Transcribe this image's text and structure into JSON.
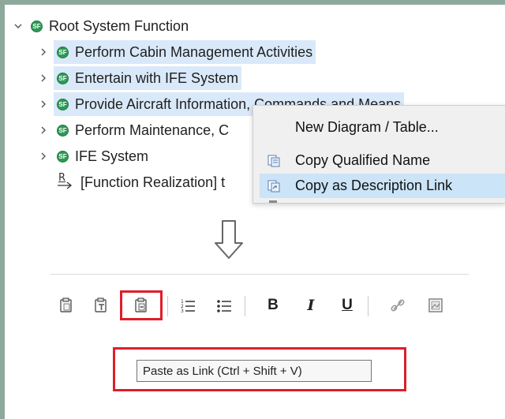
{
  "tree": {
    "root_label": "Root System Function",
    "root_icon": "sf-function-icon",
    "icon_glyph": "SF",
    "items": [
      {
        "label": "Perform Cabin Management Activities",
        "icon": "sf-function-icon",
        "highlighted": true
      },
      {
        "label": "Entertain with IFE System",
        "icon": "sf-function-icon",
        "highlighted": true
      },
      {
        "label": "Provide Aircraft Information, Commands and Means",
        "icon": "sf-function-icon",
        "highlighted": true
      },
      {
        "label": "Perform Maintenance, C",
        "icon": "sf-function-icon",
        "highlighted": false
      },
      {
        "label": "IFE System",
        "icon": "sf-function-icon",
        "highlighted": false
      }
    ],
    "realization": {
      "glyph": "R",
      "label": "[Function Realization] t",
      "icon": "realization-arrow-icon"
    }
  },
  "context_menu": {
    "items": [
      {
        "label": "New Diagram / Table...",
        "icon": "",
        "selected": false
      },
      {
        "label": "Copy Qualified Name",
        "icon": "copy-qualified-name-icon",
        "selected": false
      },
      {
        "label": "Copy as Description Link",
        "icon": "copy-description-link-icon",
        "selected": true
      }
    ]
  },
  "arrow_icon": "down-outline-arrow-icon",
  "toolbar": {
    "buttons": [
      {
        "name": "paste-button",
        "icon": "paste-icon"
      },
      {
        "name": "paste-text-button",
        "icon": "paste-text-icon"
      },
      {
        "name": "paste-as-link-button",
        "icon": "paste-link-icon",
        "highlighted": true
      },
      {
        "name": "numbered-list-button",
        "icon": "numbered-list-icon"
      },
      {
        "name": "bulleted-list-button",
        "icon": "bulleted-list-icon"
      },
      {
        "name": "bold-button",
        "icon": "bold-icon",
        "text": "B"
      },
      {
        "name": "italic-button",
        "icon": "italic-icon",
        "text": "I"
      },
      {
        "name": "underline-button",
        "icon": "underline-icon",
        "text": "U"
      },
      {
        "name": "link-button",
        "icon": "link-icon"
      },
      {
        "name": "image-button",
        "icon": "image-icon"
      }
    ]
  },
  "tooltip": {
    "text": "Paste as Link (Ctrl + Shift + V)"
  },
  "colors": {
    "highlight": "#d9e9f9",
    "menu_selected": "#cce4f7",
    "annotation_red": "#e01d2a",
    "function_green": "#2c9b55",
    "frame_green": "#8fa89c"
  }
}
